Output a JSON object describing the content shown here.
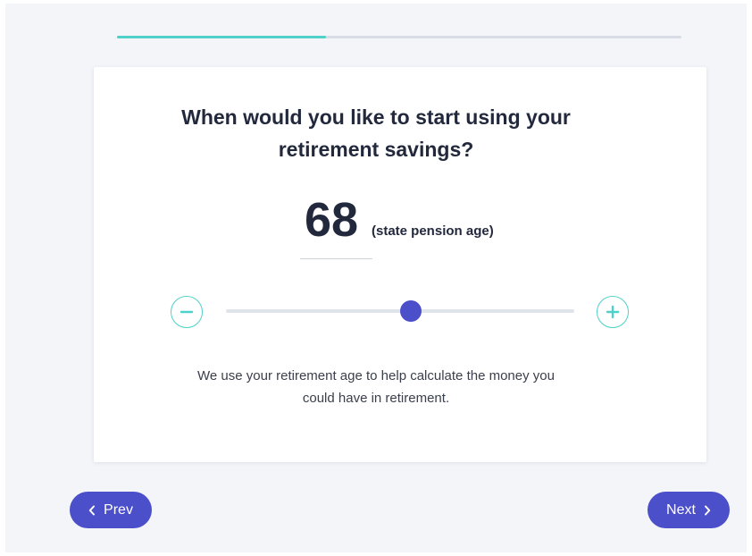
{
  "progress": {
    "fraction": 0.37
  },
  "question": {
    "line1": "When would you like to start using your",
    "line2": "retirement savings?"
  },
  "age": {
    "value": "68",
    "note": "(state pension age)"
  },
  "slider": {
    "position_fraction": 0.53,
    "decrement_icon": "minus-icon",
    "increment_icon": "plus-icon"
  },
  "info": {
    "line1": "We use your retirement age to help calculate the money you",
    "line2": "could have in retirement."
  },
  "navigation": {
    "prev_label": "Prev",
    "next_label": "Next"
  },
  "colors": {
    "accent": "#4b4fc9",
    "progress": "#4fd1c9",
    "text": "#23293d"
  }
}
